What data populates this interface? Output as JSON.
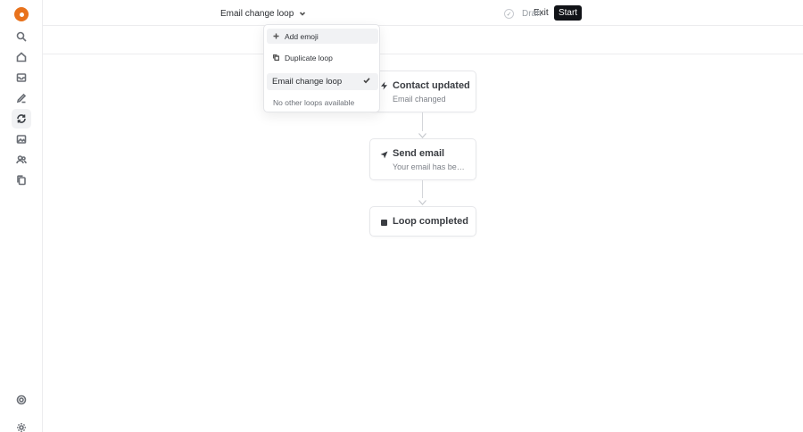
{
  "sidebar": {
    "logo": "loops-logo-icon",
    "items": [
      {
        "name": "search",
        "icon": "search-icon"
      },
      {
        "name": "home",
        "icon": "home-icon"
      },
      {
        "name": "inbox",
        "icon": "inbox-icon"
      },
      {
        "name": "compose",
        "icon": "pencil-icon"
      },
      {
        "name": "loops",
        "icon": "loop-icon",
        "active": true
      },
      {
        "name": "gallery",
        "icon": "image-icon"
      },
      {
        "name": "audience",
        "icon": "users-icon"
      },
      {
        "name": "templates",
        "icon": "copy-icon"
      }
    ],
    "bottom": [
      {
        "name": "help",
        "icon": "help-icon"
      },
      {
        "name": "settings",
        "icon": "settings-icon"
      }
    ]
  },
  "header": {
    "loop_title": "Email change loop",
    "exit_label": "Exit",
    "start_label": "Start"
  },
  "subbar": {
    "status": "Draft"
  },
  "dropdown": {
    "add_emoji": "Add emoji",
    "duplicate": "Duplicate loop",
    "selected": "Email change loop",
    "empty_note": "No other loops available"
  },
  "flow": {
    "trigger_title": "Contact updated",
    "trigger_sub": "Email changed",
    "action_title": "Send email",
    "action_sub": "Your email has been changed",
    "end_title": "Loop completed"
  },
  "colors": {
    "brand": "#e8721c",
    "primary_button": "#111317"
  }
}
